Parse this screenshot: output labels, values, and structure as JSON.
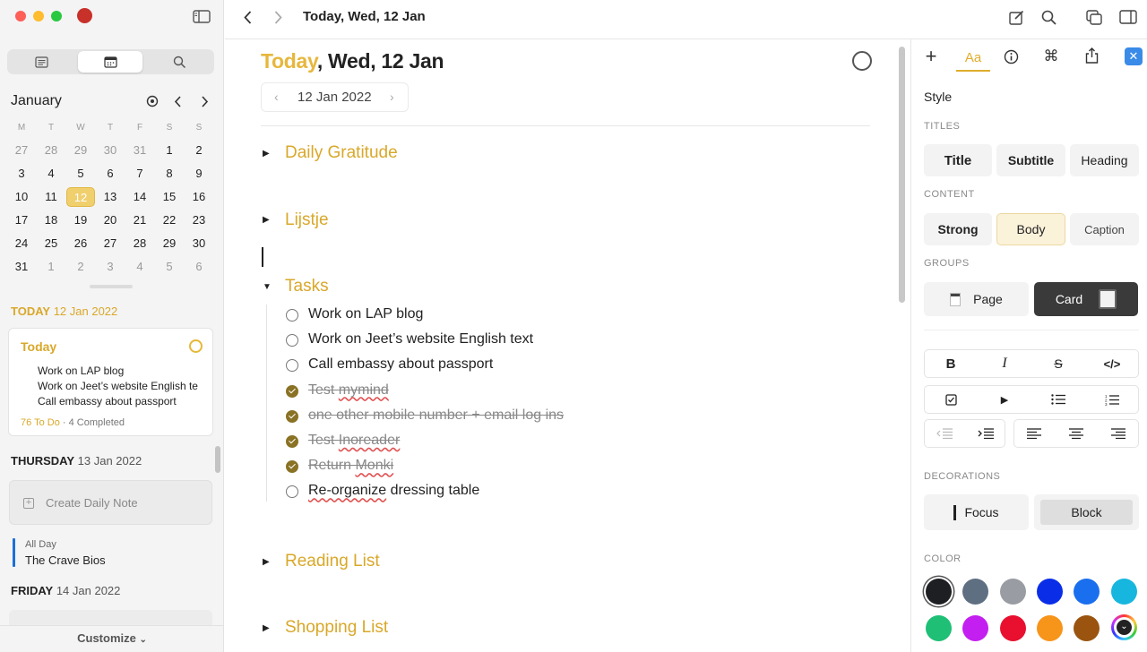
{
  "sidebar": {
    "segments": [
      "notes-icon",
      "calendar-icon",
      "search-icon"
    ],
    "calendar": {
      "month": "January",
      "weekdays": [
        "M",
        "T",
        "W",
        "T",
        "F",
        "S",
        "S"
      ],
      "weeks": [
        [
          "27",
          "28",
          "29",
          "30",
          "31",
          "1",
          "2"
        ],
        [
          "3",
          "4",
          "5",
          "6",
          "7",
          "8",
          "9"
        ],
        [
          "10",
          "11",
          "12",
          "13",
          "14",
          "15",
          "16"
        ],
        [
          "17",
          "18",
          "19",
          "20",
          "21",
          "22",
          "23"
        ],
        [
          "24",
          "25",
          "26",
          "27",
          "28",
          "29",
          "30"
        ],
        [
          "31",
          "1",
          "2",
          "3",
          "4",
          "5",
          "6"
        ]
      ]
    },
    "today_section": {
      "label": "TODAY",
      "date": "12 Jan 2022"
    },
    "today_card": {
      "title": "Today",
      "tasks": [
        "Work on LAP blog",
        "Work on Jeet’s website English te",
        "Call embassy about passport"
      ],
      "todo": "76 To Do",
      "completed": "· 4 Completed"
    },
    "thursday": {
      "label": "THURSDAY",
      "date": "13 Jan 2022",
      "create": "Create Daily Note"
    },
    "event": {
      "kind": "All Day",
      "title": "The Crave Bios"
    },
    "friday": {
      "label": "FRIDAY",
      "date": "14 Jan 2022"
    },
    "customize": "Customize"
  },
  "topbar": {
    "title": "Today, Wed, 12 Jan"
  },
  "main": {
    "title_today": "Today",
    "title_rest": ", Wed, 12 Jan",
    "date_nav": "12 Jan 2022",
    "sections": {
      "gratitude": "Daily Gratitude",
      "lijstje": "Lijstje",
      "tasks": "Tasks",
      "reading": "Reading List",
      "shopping": "Shopping List"
    },
    "tasks": [
      {
        "text": "Work on LAP blog",
        "done": false
      },
      {
        "text": "Work on Jeet’s website English text",
        "done": false
      },
      {
        "text": "Call embassy about passport",
        "done": false
      },
      {
        "text": "Test mymind",
        "done": true
      },
      {
        "text": "one other mobile number + email log ins",
        "done": true
      },
      {
        "text": "Test Inoreader",
        "done": true
      },
      {
        "text": "Return Monki",
        "done": true
      },
      {
        "text": "Re-organize dressing table",
        "done": false
      }
    ]
  },
  "panel": {
    "style": "Style",
    "titles_label": "TITLES",
    "titles": [
      "Title",
      "Subtitle",
      "Heading"
    ],
    "content_label": "CONTENT",
    "content": [
      "Strong",
      "Body",
      "Caption"
    ],
    "groups_label": "GROUPS",
    "groups": [
      "Page",
      "Card"
    ],
    "decorations_label": "DECORATIONS",
    "decorations": [
      "Focus",
      "Block"
    ],
    "color_label": "COLOR",
    "colors": [
      "#1d1f22",
      "#5f6f82",
      "#9a9ca3",
      "#0a2ee8",
      "#1a6fee",
      "#16b6de",
      "#1fbf76",
      "#c31ff0",
      "#e8102e",
      "#f7941a",
      "#9a5410"
    ]
  }
}
